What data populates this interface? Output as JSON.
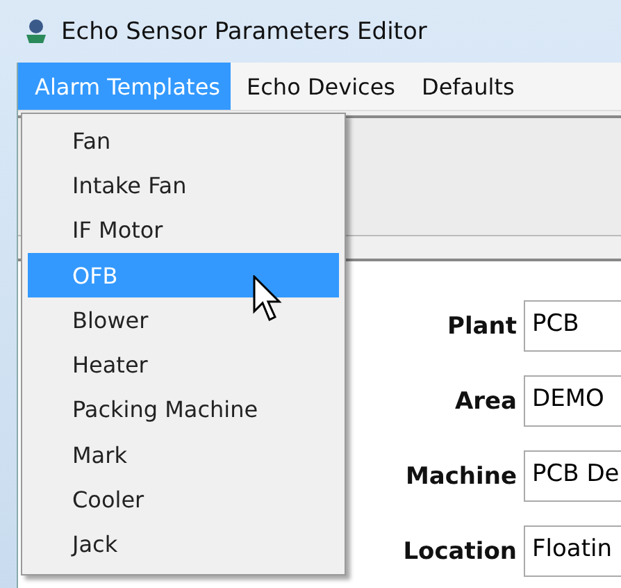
{
  "window": {
    "title": "Echo Sensor Parameters Editor"
  },
  "menubar": [
    {
      "label": "Alarm Templates",
      "selected": true
    },
    {
      "label": "Echo Devices",
      "selected": false
    },
    {
      "label": "Defaults",
      "selected": false
    }
  ],
  "menu": [
    {
      "label": "Fan",
      "selected": false
    },
    {
      "label": "Intake Fan",
      "selected": false
    },
    {
      "label": "IF Motor",
      "selected": false
    },
    {
      "label": "OFB",
      "selected": true
    },
    {
      "label": "Blower",
      "selected": false
    },
    {
      "label": "Heater",
      "selected": false
    },
    {
      "label": "Packing Machine",
      "selected": false
    },
    {
      "label": "Mark",
      "selected": false
    },
    {
      "label": "Cooler",
      "selected": false
    },
    {
      "label": "Jack",
      "selected": false
    }
  ],
  "form": [
    {
      "label": "Plant",
      "value": "PCB"
    },
    {
      "label": "Area",
      "value": "DEMO"
    },
    {
      "label": "Machine",
      "value": "PCB De"
    },
    {
      "label": "Location",
      "value": "Floatin"
    }
  ]
}
